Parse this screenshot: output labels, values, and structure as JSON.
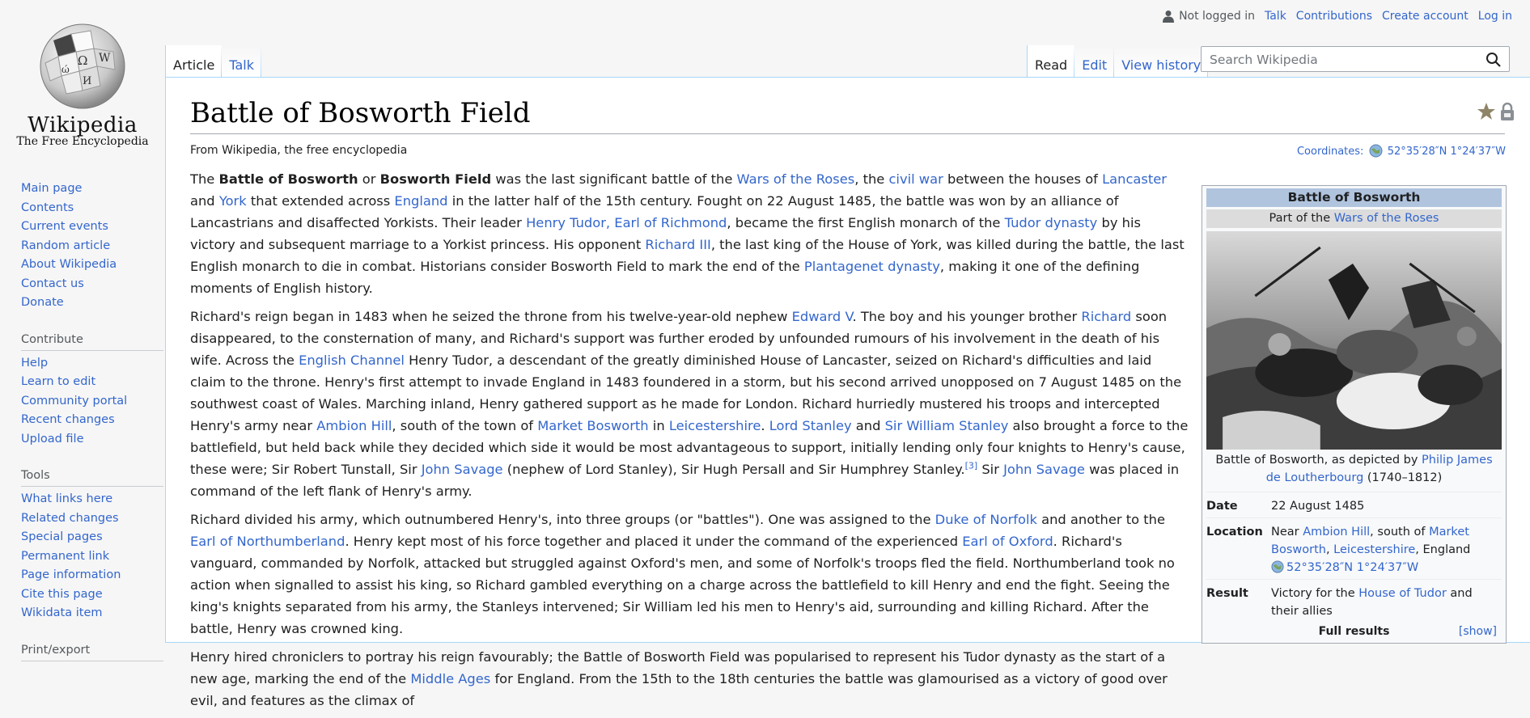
{
  "logo": {
    "wordmark": "Wikipedia",
    "tagline": "The Free Encyclopedia"
  },
  "sidebar": {
    "nav": [
      "Main page",
      "Contents",
      "Current events",
      "Random article",
      "About Wikipedia",
      "Contact us",
      "Donate"
    ],
    "contribute": {
      "heading": "Contribute",
      "items": [
        "Help",
        "Learn to edit",
        "Community portal",
        "Recent changes",
        "Upload file"
      ]
    },
    "tools": {
      "heading": "Tools",
      "items": [
        "What links here",
        "Related changes",
        "Special pages",
        "Permanent link",
        "Page information",
        "Cite this page",
        "Wikidata item"
      ]
    },
    "print_heading": "Print/export"
  },
  "personal": {
    "not_logged_in": "Not logged in",
    "talk": "Talk",
    "contributions": "Contributions",
    "create_account": "Create account",
    "login": "Log in"
  },
  "tabs": {
    "left": [
      "Article",
      "Talk"
    ],
    "right": [
      "Read",
      "Edit",
      "View history"
    ]
  },
  "search": {
    "placeholder": "Search Wikipedia"
  },
  "page": {
    "title": "Battle of Bosworth Field",
    "tagline": "From Wikipedia, the free encyclopedia",
    "coords_label": "Coordinates:",
    "coords_value": "52°35′28″N 1°24′37″W"
  },
  "infobox": {
    "title": "Battle of Bosworth",
    "part_of_prefix": "Part of the ",
    "part_of_link": "Wars of the Roses",
    "caption_prefix": "Battle of Bosworth, as depicted by ",
    "caption_link": "Philip James de Loutherbourg",
    "caption_suffix": " (1740–1812)",
    "date_label": "Date",
    "date_value": "22 August 1485",
    "location_label": "Location",
    "location_near": "Near ",
    "location_l1": "Ambion Hill",
    "location_south": ", south of ",
    "location_l2": "Market Bosworth",
    "location_comma": ", ",
    "location_l3": "Leicestershire",
    "location_end": ", England",
    "location_coords": "52°35′28″N 1°24′37″W",
    "result_label": "Result",
    "result_prefix": "Victory for the ",
    "result_link": "House of Tudor",
    "result_suffix": " and their allies",
    "full_results": "Full results",
    "show": "[show]"
  },
  "body": {
    "p1": [
      {
        "t": "The "
      },
      {
        "b": "Battle of Bosworth"
      },
      {
        "t": " or "
      },
      {
        "b": "Bosworth Field"
      },
      {
        "t": " was the last significant battle of the "
      },
      {
        "a": "Wars of the Roses"
      },
      {
        "t": ", the "
      },
      {
        "a": "civil war"
      },
      {
        "t": " between the houses of "
      },
      {
        "a": "Lancaster"
      },
      {
        "t": " and "
      },
      {
        "a": "York"
      },
      {
        "t": " that extended across "
      },
      {
        "a": "England"
      },
      {
        "t": " in the latter half of the 15th century. Fought on 22 August 1485, the battle was won by an alliance of Lancastrians and disaffected Yorkists. Their leader "
      },
      {
        "a": "Henry Tudor, Earl of Richmond"
      },
      {
        "t": ", became the first English monarch of the "
      },
      {
        "a": "Tudor dynasty"
      },
      {
        "t": " by his victory and subsequent marriage to a Yorkist princess. His opponent "
      },
      {
        "a": "Richard III"
      },
      {
        "t": ", the last king of the House of York, was killed during the battle, the last English monarch to die in combat. Historians consider Bosworth Field to mark the end of the "
      },
      {
        "a": "Plantagenet dynasty"
      },
      {
        "t": ", making it one of the defining moments of English history."
      }
    ],
    "p2": [
      {
        "t": "Richard's reign began in 1483 when he seized the throne from his twelve-year-old nephew "
      },
      {
        "a": "Edward V"
      },
      {
        "t": ". The boy and his younger brother "
      },
      {
        "a": "Richard"
      },
      {
        "t": " soon disappeared, to the consternation of many, and Richard's support was further eroded by unfounded rumours of his involvement in the death of his wife. Across the "
      },
      {
        "a": "English Channel"
      },
      {
        "t": " Henry Tudor, a descendant of the greatly diminished House of Lancaster, seized on Richard's difficulties and laid claim to the throne. Henry's first attempt to invade England in 1483 foundered in a storm, but his second arrived unopposed on 7 August 1485 on the southwest coast of Wales. Marching inland, Henry gathered support as he made for London. Richard hurriedly mustered his troops and intercepted Henry's army near "
      },
      {
        "a": "Ambion Hill"
      },
      {
        "t": ", south of the town of "
      },
      {
        "a": "Market Bosworth"
      },
      {
        "t": " in "
      },
      {
        "a": "Leicestershire"
      },
      {
        "t": ". "
      },
      {
        "a": "Lord Stanley"
      },
      {
        "t": " and "
      },
      {
        "a": "Sir William Stanley"
      },
      {
        "t": " also brought a force to the battlefield, but held back while they decided which side it would be most advantageous to support, initially lending only four knights to Henry's cause, these were; Sir Robert Tunstall, Sir "
      },
      {
        "a": "John Savage"
      },
      {
        "t": " (nephew of Lord Stanley), Sir Hugh Persall and Sir Humphrey Stanley."
      },
      {
        "sup": "[3]"
      },
      {
        "t": " Sir "
      },
      {
        "a": "John Savage"
      },
      {
        "t": " was placed in command of the left flank of Henry's army."
      }
    ],
    "p3": [
      {
        "t": "Richard divided his army, which outnumbered Henry's, into three groups (or \"battles\"). One was assigned to the "
      },
      {
        "a": "Duke of Norfolk"
      },
      {
        "t": " and another to the "
      },
      {
        "a": "Earl of Northumberland"
      },
      {
        "t": ". Henry kept most of his force together and placed it under the command of the experienced "
      },
      {
        "a": "Earl of Oxford"
      },
      {
        "t": ". Richard's vanguard, commanded by Norfolk, attacked but struggled against Oxford's men, and some of Norfolk's troops fled the field. Northumberland took no action when signalled to assist his king, so Richard gambled everything on a charge across the battlefield to kill Henry and end the fight. Seeing the king's knights separated from his army, the Stanleys intervened; Sir William led his men to Henry's aid, surrounding and killing Richard. After the battle, Henry was crowned king."
      }
    ],
    "p4": [
      {
        "t": "Henry hired chroniclers to portray his reign favourably; the Battle of Bosworth Field was popularised to represent his Tudor dynasty as the start of a new age, marking the end of the "
      },
      {
        "a": "Middle Ages"
      },
      {
        "t": " for England. From the 15th to the 18th centuries the battle was glamourised as a victory of good over evil, and features as the climax of"
      }
    ]
  }
}
